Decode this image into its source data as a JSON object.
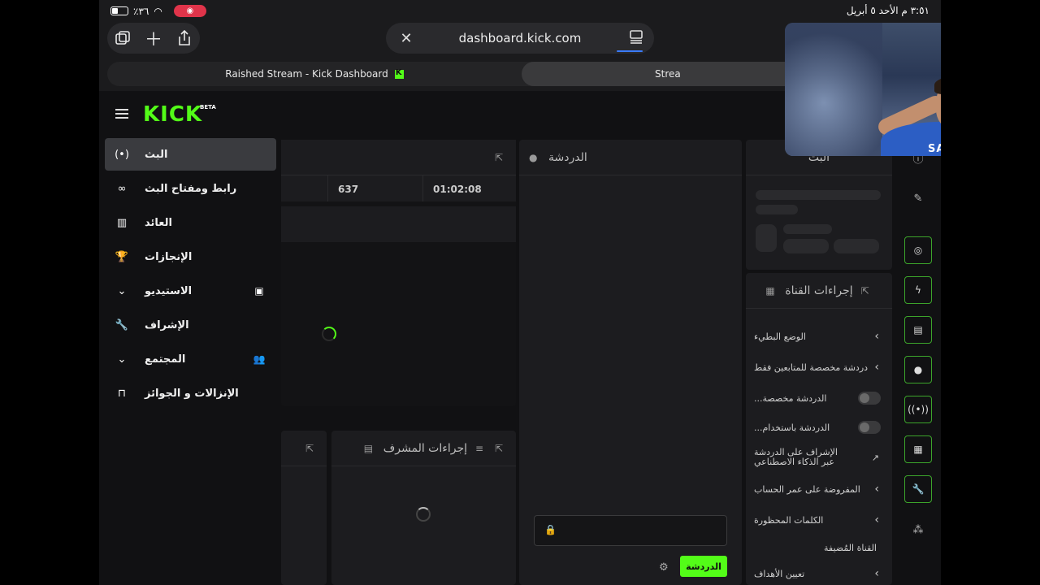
{
  "status_bar": {
    "battery_percent": "٪٣٦",
    "time_date": "٣:٥١ م   الأحد ٥ أبريل"
  },
  "browser": {
    "url": "dashboard.kick.com",
    "tabs": [
      {
        "label": "Raished Stream - Kick Dashboard"
      },
      {
        "label": "Strea"
      }
    ]
  },
  "brand": {
    "logo": "KICK",
    "beta": "BETA",
    "accent": "#53fc18"
  },
  "sidebar": {
    "items": [
      {
        "label": "البث",
        "icon": "broadcast-icon"
      },
      {
        "label": "رابط ومفتاح البث",
        "icon": "link-icon"
      },
      {
        "label": "العائد",
        "icon": "chart-icon"
      },
      {
        "label": "الإنجازات",
        "icon": "trophy-icon"
      },
      {
        "label": "الاستيديو",
        "icon": "studio-icon"
      },
      {
        "label": "الإشراف",
        "icon": "wrench-icon"
      },
      {
        "label": "المجتمع",
        "icon": "users-icon"
      },
      {
        "label": "الإنزالات و الجوائز",
        "icon": "gift-icon"
      }
    ]
  },
  "stream_panel": {
    "stats": [
      "637",
      "01:02:08"
    ]
  },
  "mod_actions": {
    "title": "إجراءات المشرف"
  },
  "chat": {
    "title": "الدردشة",
    "send_label": "الدردشة"
  },
  "stream_info": {
    "title": "البث"
  },
  "channel_actions": {
    "title": "إجراءات القناة",
    "rows": [
      {
        "label": "الوضع البطيء"
      },
      {
        "label": "دردشة مخصصة للمتابعين فقط"
      },
      {
        "label": "الدردشة مخصصة..."
      },
      {
        "label": "الدردشة باستخدام..."
      },
      {
        "label": "الإشراف على الدردشة عبر الذكاء الاصطناعي"
      },
      {
        "label": "المفروضة على عمر الحساب"
      },
      {
        "label": "الكلمات المحظورة"
      }
    ],
    "section_label": "القناة المُضيفة",
    "last_row": "تعيين الأهداف"
  },
  "pip": {
    "sponsor_text": "SAVVY"
  }
}
